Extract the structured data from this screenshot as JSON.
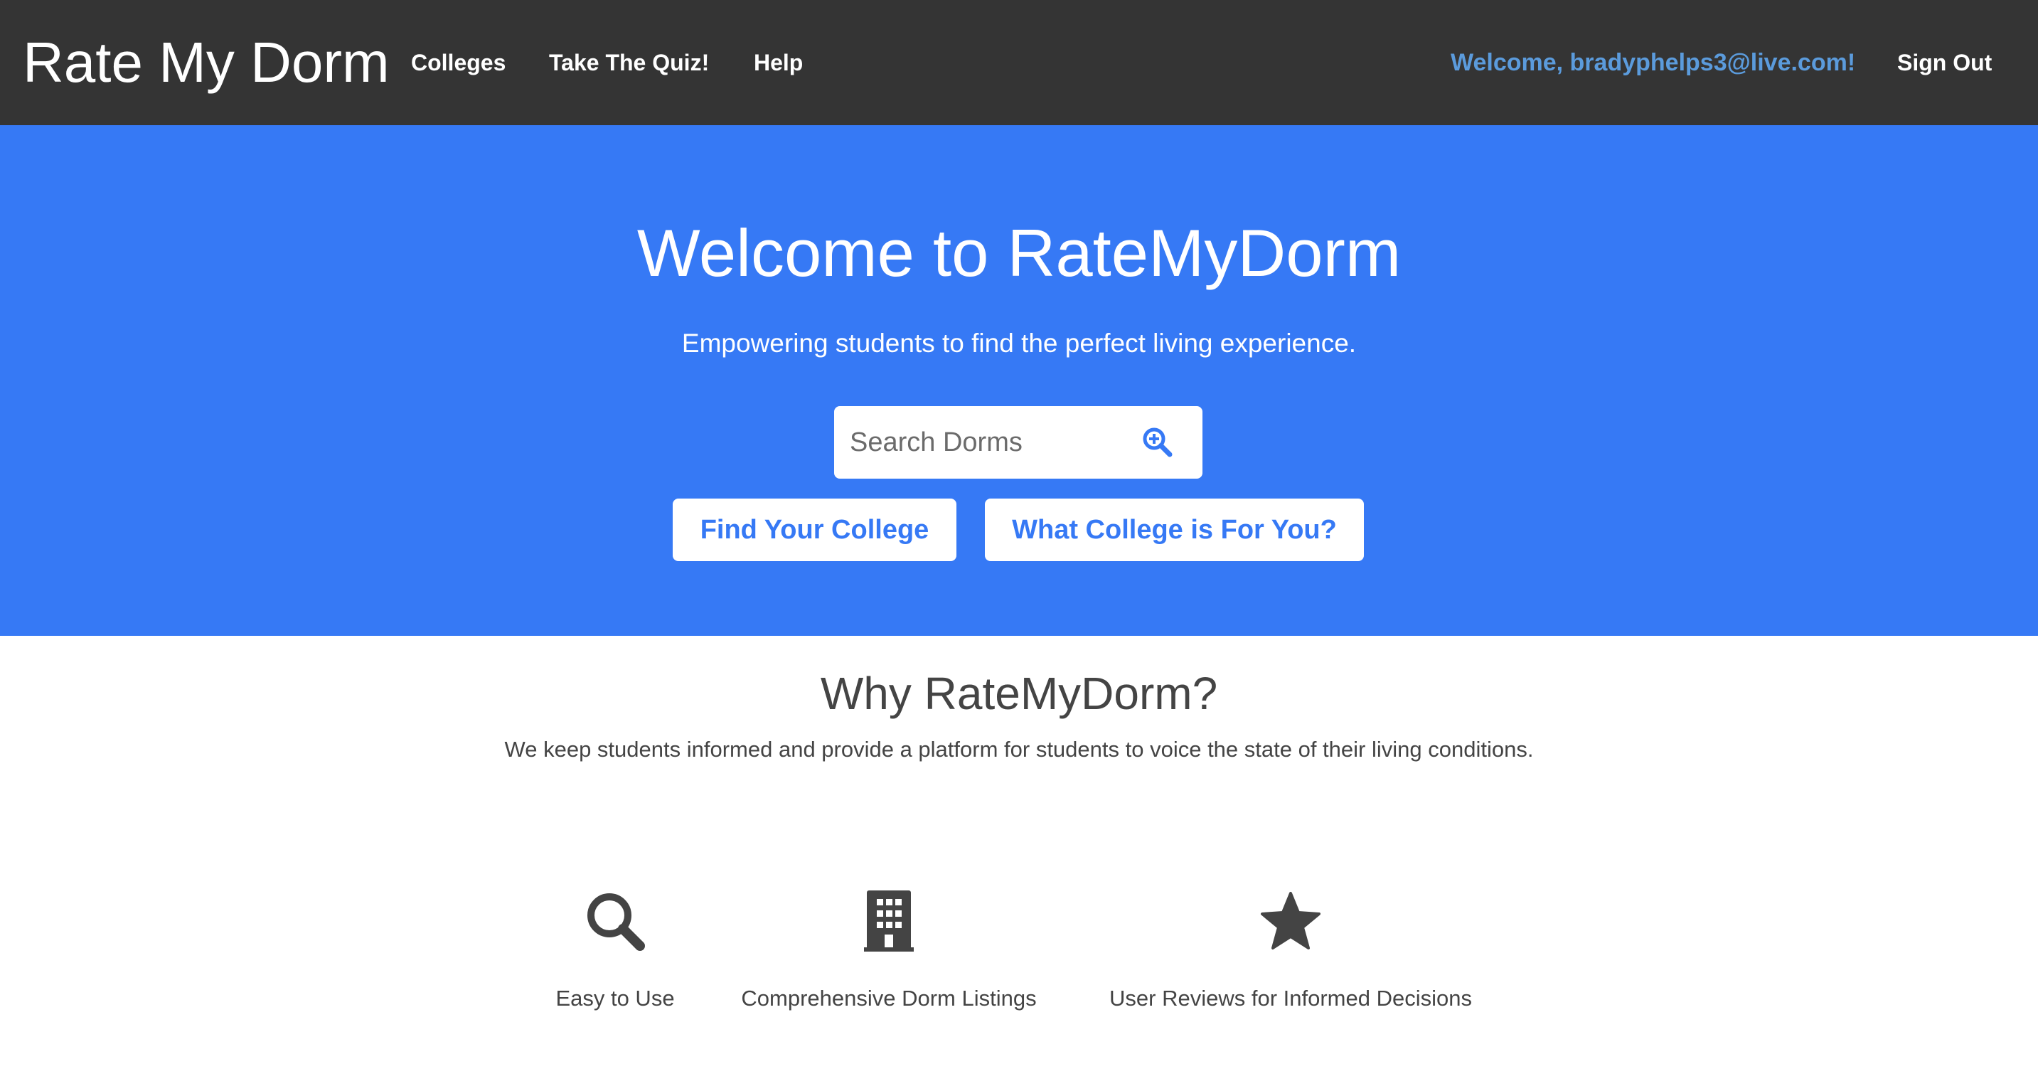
{
  "navbar": {
    "brand": "Rate My Dorm",
    "links": {
      "colleges": "Colleges",
      "quiz": "Take The Quiz!",
      "help": "Help"
    },
    "welcome": "Welcome, bradyphelps3@live.com!",
    "sign_out": "Sign Out"
  },
  "hero": {
    "title": "Welcome to RateMyDorm",
    "subtitle": "Empowering students to find the perfect living experience.",
    "search": {
      "placeholder": "Search Dorms",
      "value": "",
      "icon": "zoom-in-icon"
    },
    "buttons": {
      "find_college": "Find Your College",
      "college_quiz": "What College is For You?"
    }
  },
  "why": {
    "title": "Why RateMyDorm?",
    "text": "We keep students informed and provide a platform for students to voice the state of their living conditions."
  },
  "features": [
    {
      "icon": "search-icon",
      "label": "Easy to Use"
    },
    {
      "icon": "building-icon",
      "label": "Comprehensive Dorm Listings"
    },
    {
      "icon": "star-icon",
      "label": "User Reviews for Informed Decisions"
    }
  ],
  "colors": {
    "navbar_bg": "#343434",
    "hero_bg": "#3679f5",
    "welcome_text": "#5b9bdc",
    "body_text": "#444444"
  }
}
